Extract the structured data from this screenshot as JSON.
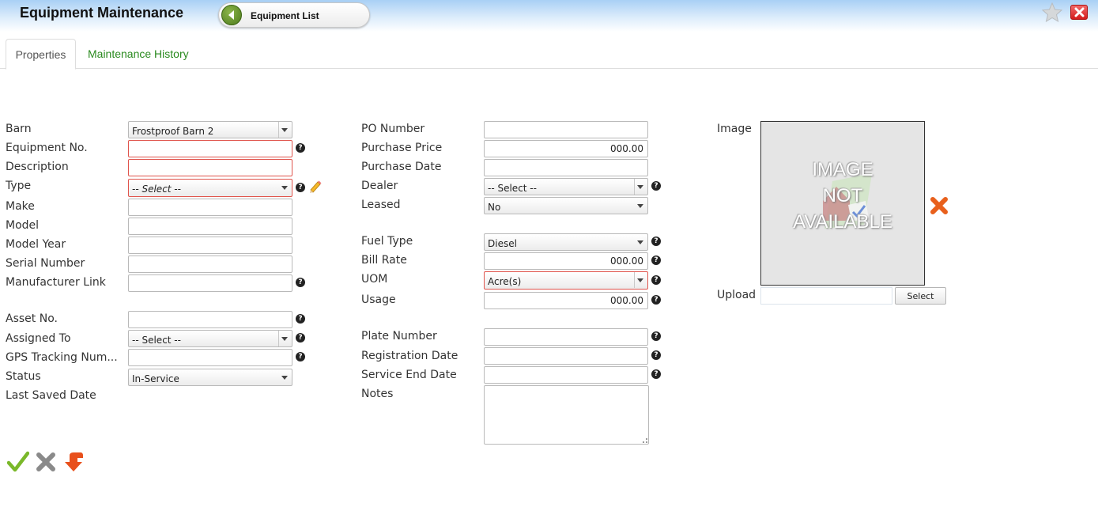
{
  "header": {
    "title": "Equipment Maintenance",
    "back_button_label": "Equipment List",
    "icons": [
      "arrow-left-icon",
      "star-icon",
      "close-icon"
    ]
  },
  "tabs": [
    {
      "label": "Properties",
      "active": true
    },
    {
      "label": "Maintenance History",
      "active": false
    }
  ],
  "left_column": {
    "barn": {
      "label": "Barn",
      "value": "Frostproof Barn 2"
    },
    "equipment_no": {
      "label": "Equipment No.",
      "value": ""
    },
    "description": {
      "label": "Description",
      "value": ""
    },
    "type": {
      "label": "Type",
      "value": "-- Select --"
    },
    "make": {
      "label": "Make",
      "value": ""
    },
    "model": {
      "label": "Model",
      "value": ""
    },
    "model_year": {
      "label": "Model Year",
      "value": ""
    },
    "serial_number": {
      "label": "Serial Number",
      "value": ""
    },
    "manufacturer_link": {
      "label": "Manufacturer Link",
      "value": ""
    },
    "asset_no": {
      "label": "Asset No.",
      "value": ""
    },
    "assigned_to": {
      "label": "Assigned To",
      "value": "-- Select --"
    },
    "gps_tracking": {
      "label": "GPS Tracking Num...",
      "value": ""
    },
    "status": {
      "label": "Status",
      "value": "In-Service"
    },
    "last_saved_date": {
      "label": "Last Saved Date",
      "value": ""
    }
  },
  "middle_column": {
    "po_number": {
      "label": "PO Number",
      "value": ""
    },
    "purchase_price": {
      "label": "Purchase Price",
      "value": "000.00"
    },
    "purchase_date": {
      "label": "Purchase Date",
      "value": ""
    },
    "dealer": {
      "label": "Dealer",
      "value": "-- Select --"
    },
    "leased": {
      "label": "Leased",
      "value": "No"
    },
    "fuel_type": {
      "label": "Fuel Type",
      "value": "Diesel"
    },
    "bill_rate": {
      "label": "Bill Rate",
      "value": "000.00"
    },
    "uom": {
      "label": "UOM",
      "value": "Acre(s)"
    },
    "usage": {
      "label": "Usage",
      "value": "000.00"
    },
    "plate_number": {
      "label": "Plate Number",
      "value": ""
    },
    "registration_date": {
      "label": "Registration Date",
      "value": ""
    },
    "service_end_date": {
      "label": "Service End Date",
      "value": ""
    },
    "notes": {
      "label": "Notes",
      "value": ""
    }
  },
  "image_panel": {
    "label": "Image",
    "placeholder_lines": [
      "IMAGE",
      "NOT",
      "AVAILABLE"
    ],
    "upload_label": "Upload",
    "upload_value": "",
    "select_button": "Select"
  },
  "help_glyph": "?",
  "actions": [
    "save-check-icon",
    "cancel-x-icon",
    "revert-arrow-icon"
  ]
}
